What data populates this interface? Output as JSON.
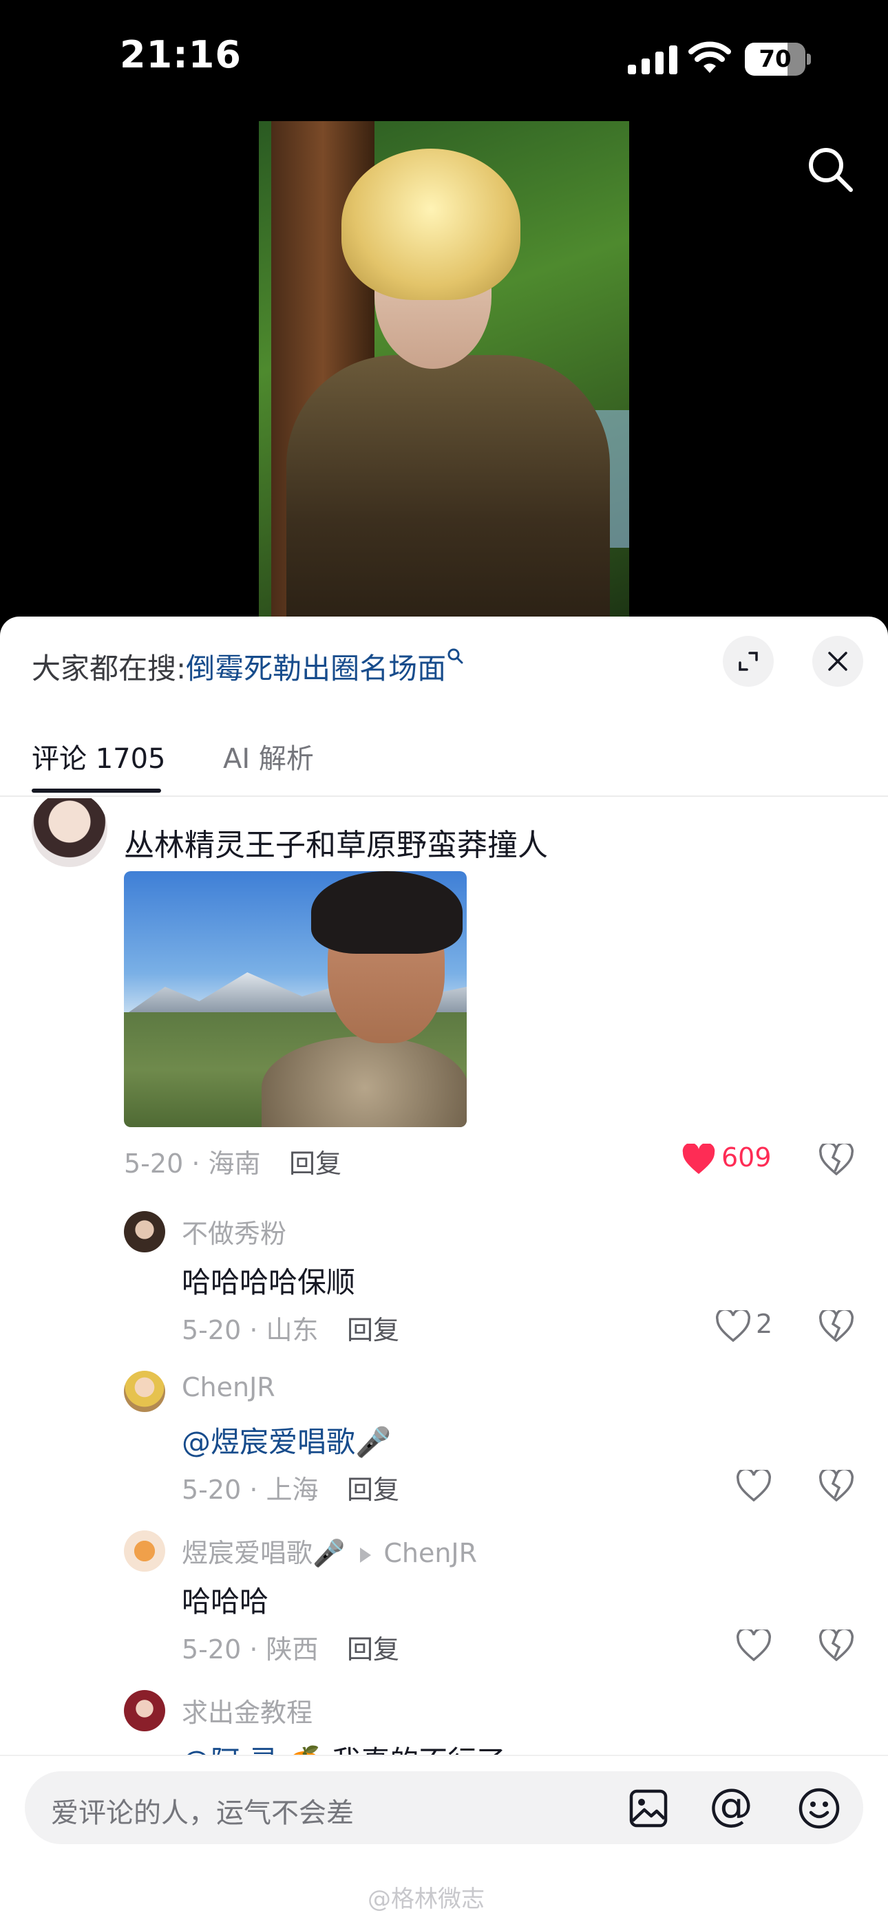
{
  "status_bar": {
    "time": "21:16",
    "battery": "70",
    "battery_level": 0.7
  },
  "sheet": {
    "hot_search_prefix": "大家都在搜:",
    "hot_search_query": "倒霉死勒出圈名场面"
  },
  "tabs": [
    {
      "label": "评论 1705",
      "active": true
    },
    {
      "label": "AI 解析",
      "active": false
    }
  ],
  "main_comment": {
    "text": "丛林精灵王子和草原野蛮莽撞人",
    "meta": "5-20 · 海南",
    "reply_label": "回复",
    "likes": "609",
    "liked": true
  },
  "replies": [
    {
      "name": "不做秀粉",
      "text": "哈哈哈哈保顺",
      "meta": "5-20 · 山东",
      "reply_label": "回复",
      "likes": "2"
    },
    {
      "name": "ChenJR",
      "mention": "@煜宸爱唱歌🎤",
      "text": "",
      "meta": "5-20 · 上海",
      "reply_label": "回复",
      "likes": ""
    },
    {
      "name": "煜宸爱唱歌🎤",
      "reply_to": "ChenJR",
      "text": "哈哈哈",
      "meta": "5-20 · 陕西",
      "reply_label": "回复",
      "likes": ""
    },
    {
      "name": "求出金教程",
      "mention": "@阿 灵.🍊",
      "text": " 我真的不行了"
    }
  ],
  "input": {
    "placeholder": "爱评论的人，运气不会差"
  },
  "watermark": "@格林微志",
  "colors": {
    "like_red": "#fe2c55",
    "link_blue": "#174c8c"
  }
}
